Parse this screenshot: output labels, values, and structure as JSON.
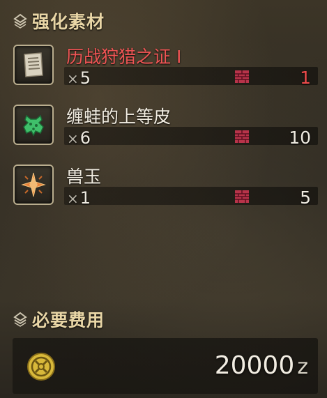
{
  "materials_section": {
    "title": "强化素材",
    "icon": "diamond-stack-icon"
  },
  "materials": [
    {
      "name": "历战狩猎之证 I",
      "qty_prefix": "×",
      "qty": "5",
      "owned": "1",
      "icon": "scroll-icon",
      "insufficient": true,
      "name_color": "#f05555"
    },
    {
      "name": "缠蛙的上等皮",
      "qty_prefix": "×",
      "qty": "6",
      "owned": "10",
      "icon": "frog-hide-icon",
      "insufficient": false,
      "name_color": "#f2ede2"
    },
    {
      "name": "兽玉",
      "qty_prefix": "×",
      "qty": "1",
      "owned": "5",
      "icon": "star-gem-icon",
      "insufficient": false,
      "name_color": "#f2ede2"
    }
  ],
  "cost_section": {
    "title": "必要费用",
    "icon": "diamond-stack-icon",
    "amount": "20000",
    "unit": "z",
    "coin_icon": "zenny-coin-icon"
  },
  "colors": {
    "header_gold": "#e9d6a6",
    "warning_red": "#ee4b4b",
    "box_red": "#b8344a"
  }
}
